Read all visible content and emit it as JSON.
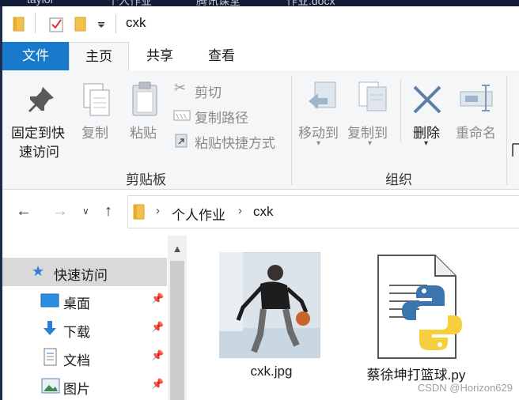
{
  "desktop_strip": {
    "items": [
      "taylor",
      "个人作业",
      "腾讯课堂",
      "作业.docx"
    ]
  },
  "window": {
    "title": "cxk"
  },
  "ribbon_tabs": [
    "文件",
    "主页",
    "共享",
    "查看"
  ],
  "ribbon": {
    "clipboard": {
      "pin_label_1": "固定到快",
      "pin_label_2": "速访问",
      "copy_label": "复制",
      "paste_label": "粘贴",
      "cut_label": "剪切",
      "copy_path_label": "复制路径",
      "paste_shortcut_label": "粘贴快捷方式",
      "group_label": "剪贴板"
    },
    "organize": {
      "move_to_label": "移动到",
      "copy_to_label": "复制到",
      "delete_label": "删除",
      "rename_label": "重命名",
      "group_label": "组织"
    }
  },
  "address": {
    "crumbs": [
      "个人作业",
      "cxk"
    ]
  },
  "nav": {
    "items": [
      {
        "label": "快速访问",
        "icon": "star-icon",
        "selected": true
      },
      {
        "label": "桌面",
        "icon": "desktop-icon",
        "pinned": true
      },
      {
        "label": "下载",
        "icon": "download-arrow-icon",
        "pinned": true
      },
      {
        "label": "文档",
        "icon": "document-icon",
        "pinned": true
      },
      {
        "label": "图片",
        "icon": "picture-icon",
        "pinned": true
      }
    ]
  },
  "files": [
    {
      "name": "cxk.jpg",
      "icon": "image-thumbnail"
    },
    {
      "name": "蔡徐坤打篮球.py",
      "icon": "python-file-icon"
    }
  ],
  "watermark": "CSDN @Horizon629",
  "colors": {
    "file_tab": "#1979ca",
    "ribbon_bg": "#f5f6f7",
    "selected_nav": "#d9d9d9",
    "folder": "#f3c04c"
  }
}
